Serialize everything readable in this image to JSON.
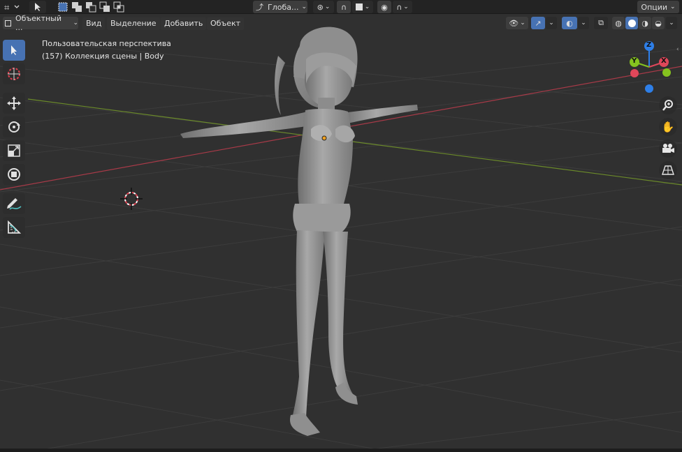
{
  "header": {
    "mode_label": "Объектный ...",
    "menus": [
      "Вид",
      "Выделение",
      "Добавить",
      "Объект"
    ],
    "transform_orientation": "Глоба...",
    "options_label": "Опции"
  },
  "viewport": {
    "view_name": "Пользовательская перспектива",
    "collection_info": "(157) Коллекция сцены | Body"
  },
  "gizmo": {
    "axis_z": "Z",
    "axis_y": "Y",
    "axis_x": "X"
  },
  "toolbar": {
    "tools": [
      "select-box",
      "cursor",
      "move",
      "rotate",
      "scale",
      "transform",
      "annotate",
      "measure"
    ]
  },
  "colors": {
    "accent": "#4772b3",
    "axis_x": "#e0475a",
    "axis_y": "#85c21f",
    "axis_z": "#2e7fe8",
    "viewport_bg": "#303030"
  }
}
